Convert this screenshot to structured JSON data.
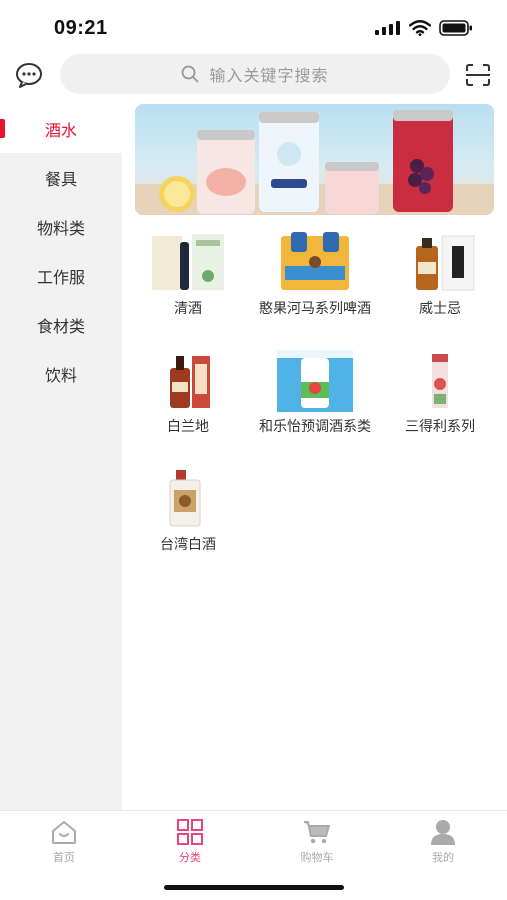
{
  "status_bar": {
    "time": "09:21"
  },
  "search": {
    "placeholder": "输入关键字搜索"
  },
  "sidebar": {
    "items": [
      {
        "label": "酒水",
        "active": true
      },
      {
        "label": "餐具",
        "active": false
      },
      {
        "label": "物料类",
        "active": false
      },
      {
        "label": "工作服",
        "active": false
      },
      {
        "label": "食材类",
        "active": false
      },
      {
        "label": "饮料",
        "active": false
      }
    ]
  },
  "categories": [
    {
      "label": "清酒",
      "icon": "sake-bottle-icon"
    },
    {
      "label": "憨果河马系列啤酒",
      "icon": "beer-cans-icon"
    },
    {
      "label": "威士忌",
      "icon": "whisky-bottle-icon"
    },
    {
      "label": "白兰地",
      "icon": "brandy-bottle-icon"
    },
    {
      "label": "和乐怡预调酒系类",
      "icon": "horoyoi-can-icon"
    },
    {
      "label": "三得利系列",
      "icon": "suntory-bottle-icon"
    },
    {
      "label": "台湾白酒",
      "icon": "baijiu-bottle-icon"
    }
  ],
  "tabbar": {
    "items": [
      {
        "label": "首页",
        "icon": "home-icon",
        "active": false
      },
      {
        "label": "分类",
        "icon": "category-grid-icon",
        "active": true
      },
      {
        "label": "购物车",
        "icon": "cart-icon",
        "active": false
      },
      {
        "label": "我的",
        "icon": "user-icon",
        "active": false
      }
    ]
  },
  "colors": {
    "accent": "#e8132f",
    "tab_active": "#e8467a",
    "sidebar_bg": "#f2f2f2"
  }
}
